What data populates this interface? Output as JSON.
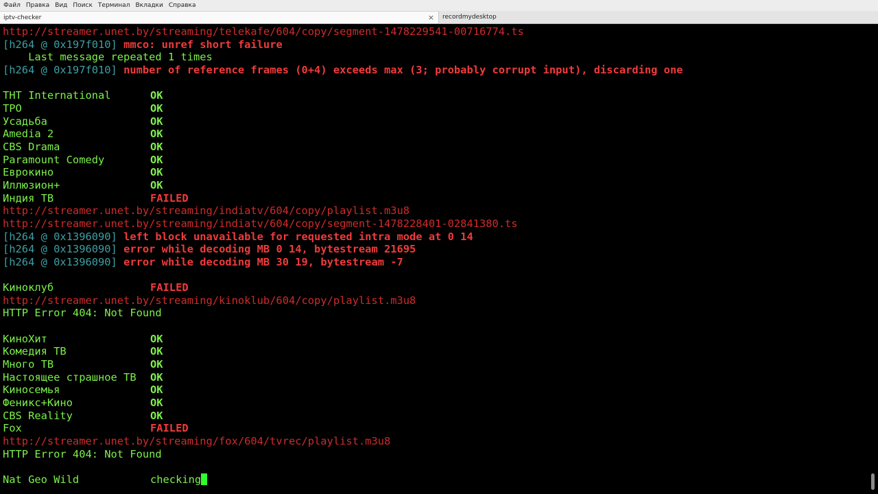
{
  "menu": [
    "Файл",
    "Правка",
    "Вид",
    "Поиск",
    "Терминал",
    "Вкладки",
    "Справка"
  ],
  "tabs": [
    {
      "label": "iptv-checker",
      "close": "×"
    },
    {
      "label": "recordmydesktop"
    }
  ],
  "terminal": {
    "lines": [
      {
        "url": "http://streamer.unet.by/streaming/telekafe/604/copy/segment-1478229541-00716774.ts"
      },
      {
        "tag": "[h264 @ 0x197f010]",
        "msg": "mmco: unref short failure"
      },
      {
        "text": "    Last message repeated 1 times"
      },
      {
        "tag": "[h264 @ 0x197f010]",
        "msg": "number of reference frames (0+4) exceeds max (3; probably corrupt input), discarding one"
      },
      {},
      {
        "channel": "THT International",
        "status": "OK"
      },
      {
        "channel": "TPO",
        "status": "OK"
      },
      {
        "channel": "Усадьба",
        "status": "OK"
      },
      {
        "channel": "Amedia 2",
        "status": "OK"
      },
      {
        "channel": "CBS Drama",
        "status": "OK"
      },
      {
        "channel": "Paramount Comedy",
        "status": "OK"
      },
      {
        "channel": "Еврокино",
        "status": "OK"
      },
      {
        "channel": "Иллюзион+",
        "status": "OK"
      },
      {
        "channel": "Индия ТВ",
        "status": "FAILED"
      },
      {
        "url": "http://streamer.unet.by/streaming/indiatv/604/copy/playlist.m3u8"
      },
      {
        "url": "http://streamer.unet.by/streaming/indiatv/604/copy/segment-1478228401-02841380.ts"
      },
      {
        "tag": "[h264 @ 0x1396090]",
        "msg": "left block unavailable for requested intra mode at 0 14"
      },
      {
        "tag": "[h264 @ 0x1396090]",
        "msg": "error while decoding MB 0 14, bytestream 21695"
      },
      {
        "tag": "[h264 @ 0x1396090]",
        "msg": "error while decoding MB 30 19, bytestream -7"
      },
      {},
      {
        "channel": "Киноклуб",
        "status": "FAILED"
      },
      {
        "url": "http://streamer.unet.by/streaming/kinoklub/604/copy/playlist.m3u8"
      },
      {
        "text": "HTTP Error 404: Not Found"
      },
      {},
      {
        "channel": "КиноХит",
        "status": "OK"
      },
      {
        "channel": "Комедия ТВ",
        "status": "OK"
      },
      {
        "channel": "Много ТВ",
        "status": "OK"
      },
      {
        "channel": "Настоящее страшное ТВ",
        "status": "OK"
      },
      {
        "channel": "Киносемья",
        "status": "OK"
      },
      {
        "channel": "Феникс+Кино",
        "status": "OK"
      },
      {
        "channel": "CBS Reality",
        "status": "OK"
      },
      {
        "channel": "Fox",
        "status": "FAILED"
      },
      {
        "url": "http://streamer.unet.by/streaming/fox/604/tvrec/playlist.m3u8"
      },
      {
        "text": "HTTP Error 404: Not Found"
      },
      {},
      {
        "channel": "Nat Geo Wild",
        "status": "checking",
        "cursor": true
      }
    ]
  },
  "colors": {
    "background": "#000000",
    "ok": "#7cf14a",
    "failed": "#f03b3b",
    "url": "#cf2b2b",
    "tag": "#3f9fa4",
    "cursor": "#2fff2f"
  }
}
